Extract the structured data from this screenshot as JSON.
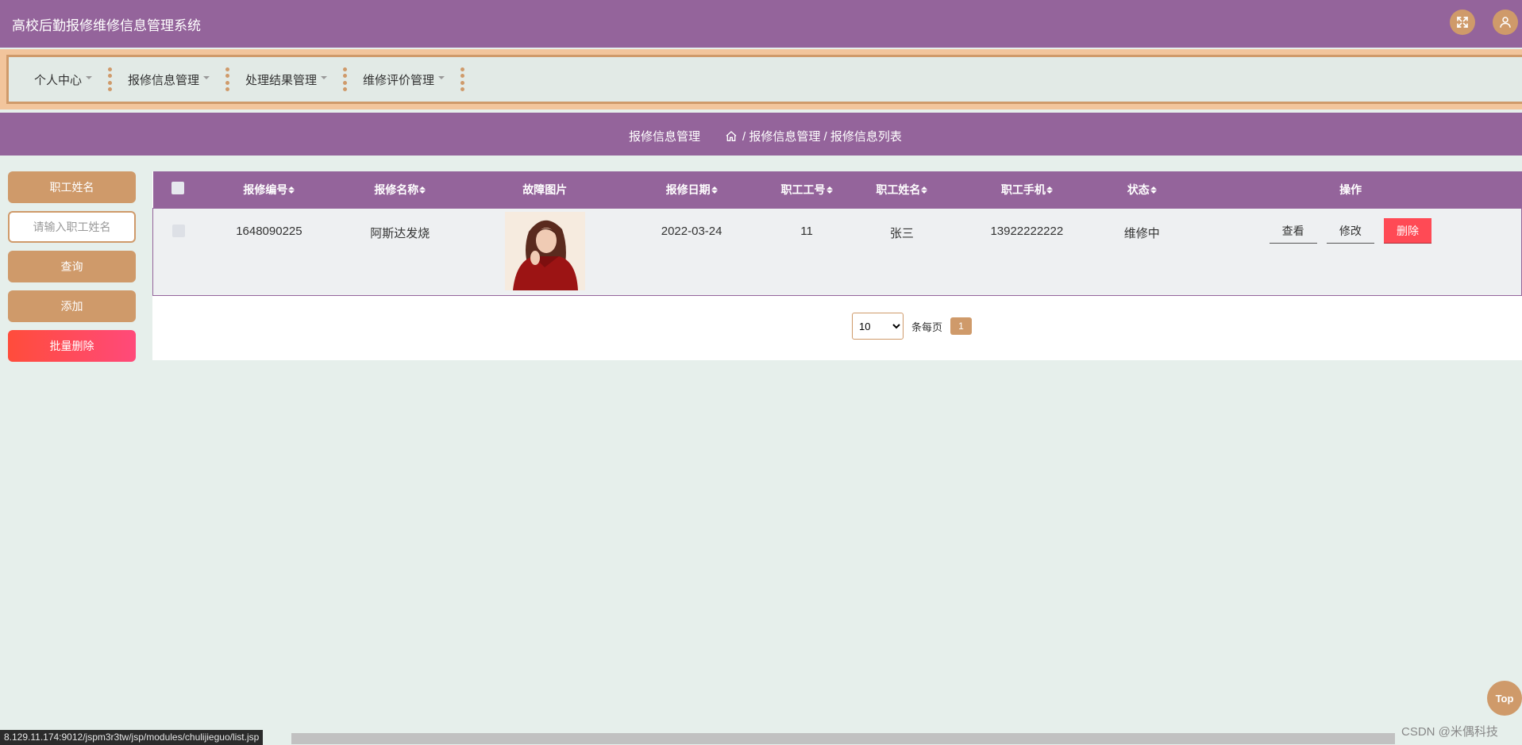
{
  "header": {
    "app_title": "高校后勤报修维修信息管理系统",
    "icons": [
      "fullscreen-icon",
      "user-icon"
    ]
  },
  "nav": {
    "items": [
      {
        "label": "个人中心"
      },
      {
        "label": "报修信息管理"
      },
      {
        "label": "处理结果管理"
      },
      {
        "label": "维修评价管理"
      }
    ]
  },
  "breadcrumb": {
    "title": "报修信息管理",
    "path": "/ 报修信息管理 / 报修信息列表",
    "icon": "home-icon"
  },
  "sidebar": {
    "field_label": "职工姓名",
    "search_placeholder": "请输入职工姓名",
    "query_label": "查询",
    "add_label": "添加",
    "batch_delete_label": "批量删除"
  },
  "table": {
    "columns": [
      "报修编号",
      "报修名称",
      "故障图片",
      "报修日期",
      "职工工号",
      "职工姓名",
      "职工手机",
      "状态",
      "操作"
    ],
    "rows": [
      {
        "id": "1648090225",
        "name": "阿斯达发烧",
        "date": "2022-03-24",
        "staff_no": "11",
        "staff_name": "张三",
        "phone": "13922222222",
        "status": "维修中",
        "actions": {
          "view": "查看",
          "edit": "修改",
          "delete": "删除"
        }
      }
    ]
  },
  "pagination": {
    "page_size": "10",
    "page_size_options": [
      "10"
    ],
    "per_page_label": "条每页",
    "current_page": "1"
  },
  "back_to_top": "Top",
  "status_url": "8.129.11.174:9012/jspm3r3tw/jsp/modules/chulijieguo/list.jsp",
  "watermark": "CSDN @米偶科技",
  "colors": {
    "primary_purple": "#94649b",
    "accent_tan": "#cf9a6a",
    "danger": "#ff4a55",
    "page_bg": "#e6efeb"
  }
}
